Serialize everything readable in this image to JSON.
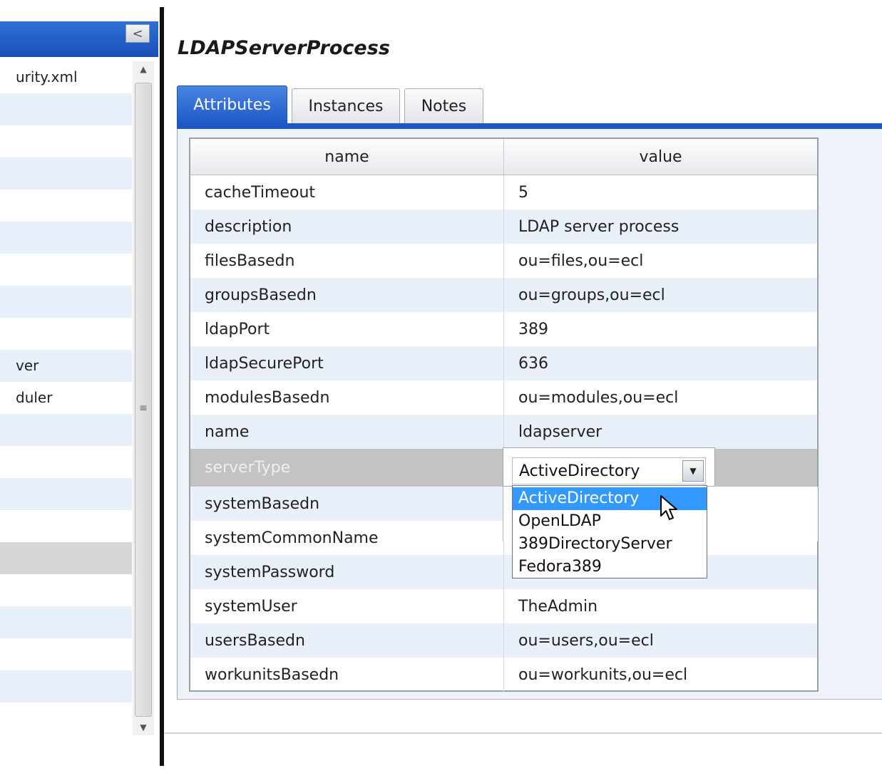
{
  "left_panel": {
    "collapse_label": "<",
    "items": [
      "urity.xml",
      "",
      "",
      "",
      "",
      "",
      "",
      "",
      "",
      "ver",
      "duler",
      "",
      "",
      "",
      "",
      "",
      "",
      "",
      "",
      "",
      ""
    ],
    "scroll_grip": "≡"
  },
  "page": {
    "title": "LDAPServerProcess"
  },
  "tabs": [
    {
      "label": "Attributes",
      "active": true
    },
    {
      "label": "Instances",
      "active": false
    },
    {
      "label": "Notes",
      "active": false
    }
  ],
  "grid": {
    "headers": {
      "name": "name",
      "value": "value"
    },
    "rows": [
      {
        "name": "cacheTimeout",
        "value": "5"
      },
      {
        "name": "description",
        "value": "LDAP server process"
      },
      {
        "name": "filesBasedn",
        "value": "ou=files,ou=ecl"
      },
      {
        "name": "groupsBasedn",
        "value": "ou=groups,ou=ecl"
      },
      {
        "name": "ldapPort",
        "value": "389"
      },
      {
        "name": "ldapSecurePort",
        "value": "636"
      },
      {
        "name": "modulesBasedn",
        "value": "ou=modules,ou=ecl"
      },
      {
        "name": "name",
        "value": "ldapserver"
      },
      {
        "name": "serverType",
        "value": ""
      },
      {
        "name": "systemBasedn",
        "value": ""
      },
      {
        "name": "systemCommonName",
        "value": ""
      },
      {
        "name": "systemPassword",
        "value": ""
      },
      {
        "name": "systemUser",
        "value": "TheAdmin"
      },
      {
        "name": "usersBasedn",
        "value": "ou=users,ou=ecl"
      },
      {
        "name": "workunitsBasedn",
        "value": "ou=workunits,ou=ecl"
      }
    ]
  },
  "server_type_select": {
    "selected": "ActiveDirectory",
    "options": [
      "ActiveDirectory",
      "OpenLDAP",
      "389DirectoryServer",
      "Fedora389"
    ],
    "highlighted_index": 0
  },
  "colors": {
    "header_blue": "#1e56c4",
    "option_highlight": "#3399ff",
    "row_alt": "#e9f0fa"
  }
}
